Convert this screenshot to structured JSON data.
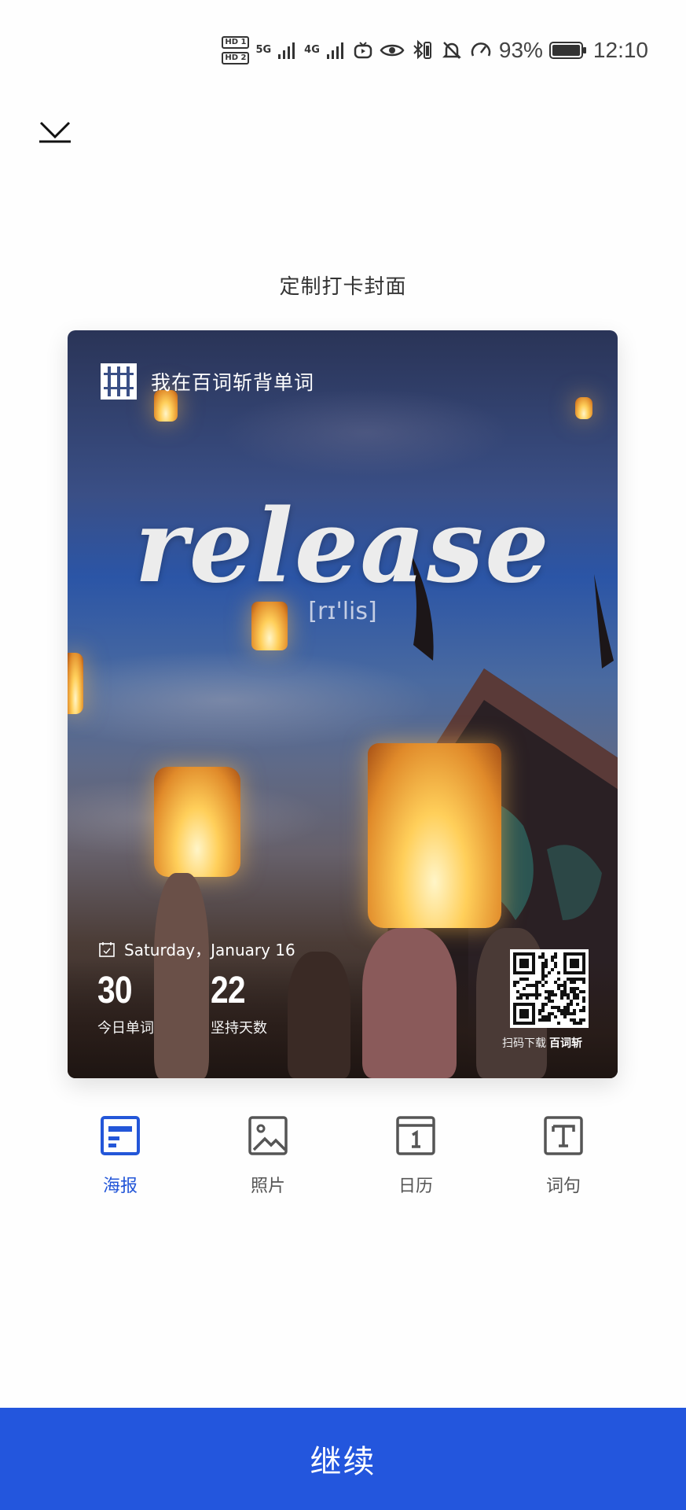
{
  "status_bar": {
    "hd1": "HD 1",
    "hd2": "HD 2",
    "net1": "5G",
    "net2": "4G",
    "battery_percent": "93%",
    "time": "12:10"
  },
  "header": {
    "close_icon": "chevron-collapse-icon",
    "title": "定制打卡封面"
  },
  "card": {
    "brand_text": "我在百词斩背单词",
    "word": "release",
    "phonetic": "[rɪ'lis]",
    "date": "Saturday，January 16",
    "today_words": {
      "value": "30",
      "label": "今日单词"
    },
    "streak_days": {
      "value": "22",
      "label": "坚持天数"
    },
    "qr_caption": "扫码下载",
    "qr_brand": "百词斩"
  },
  "tabs": [
    {
      "label": "海报",
      "icon": "poster-icon",
      "active": true
    },
    {
      "label": "照片",
      "icon": "photo-icon",
      "active": false
    },
    {
      "label": "日历",
      "icon": "calendar-icon",
      "active": false
    },
    {
      "label": "词句",
      "icon": "text-icon",
      "active": false
    }
  ],
  "continue_label": "继续",
  "colors": {
    "accent": "#2356DD",
    "tab_inactive": "#555555"
  }
}
